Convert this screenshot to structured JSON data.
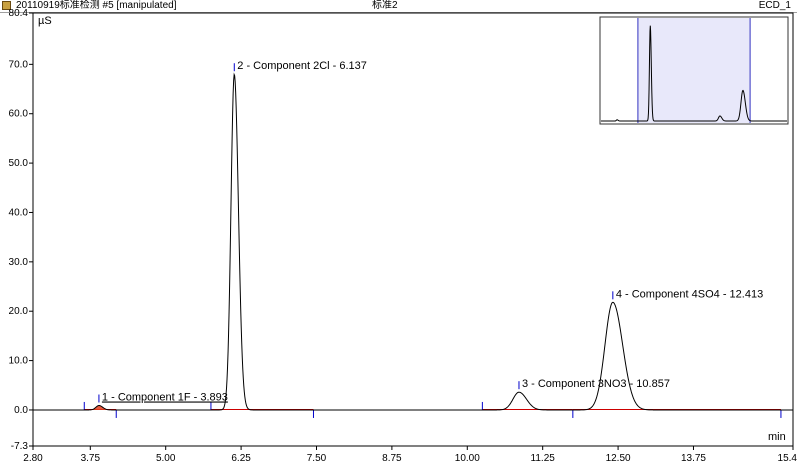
{
  "window": {
    "title": "20110919标准检测 #5 [manipulated]",
    "center_title": "标准2",
    "channel": "ECD_1"
  },
  "chart_data": {
    "type": "line",
    "ylabel": "µS",
    "xlabel": "min",
    "xlim": [
      2.8,
      15.4
    ],
    "ylim": [
      -7.3,
      80.4
    ],
    "x_ticks": [
      "2.80",
      "3.75",
      "5.00",
      "6.25",
      "7.50",
      "8.75",
      "10.00",
      "11.25",
      "12.50",
      "13.75",
      "15.4"
    ],
    "y_ticks": [
      "80.4",
      "70.0",
      "60.0",
      "50.0",
      "40.0",
      "30.0",
      "20.0",
      "10.0",
      "0.0",
      "-7.3"
    ],
    "colors": {
      "trace": "#000000",
      "baseline": "#cc0000",
      "marker": "#0000cc",
      "peak1_label": "#e04020",
      "inset_window": "#e8e8fa"
    },
    "peaks": [
      {
        "label": "1 - Component 1F - 3.893",
        "rt": 3.893,
        "height": 0.9,
        "width": 0.05,
        "color": "#e04020",
        "underline": true
      },
      {
        "label": "2 - Component 2Cl - 6.137",
        "rt": 6.137,
        "height": 68.0,
        "width": 0.055,
        "color": "#000000",
        "underline": false
      },
      {
        "label": "3 - Component 3NO3 - 10.857",
        "rt": 10.857,
        "height": 3.6,
        "width": 0.1,
        "color": "#000000",
        "underline": false
      },
      {
        "label": "4 - Component 4SO4 - 12.413",
        "rt": 12.413,
        "height": 21.8,
        "width": 0.13,
        "color": "#000000",
        "underline": false
      }
    ],
    "baseline_segments": [
      [
        3.65,
        4.18
      ],
      [
        5.75,
        7.45
      ],
      [
        10.25,
        11.75
      ],
      [
        11.75,
        15.2
      ]
    ],
    "integration_marks": [
      {
        "x": 3.65,
        "side": "up"
      },
      {
        "x": 4.18,
        "side": "down"
      },
      {
        "x": 5.75,
        "side": "up"
      },
      {
        "x": 7.45,
        "side": "down"
      },
      {
        "x": 10.25,
        "side": "up"
      },
      {
        "x": 11.75,
        "side": "down"
      },
      {
        "x": 15.2,
        "side": "down"
      }
    ],
    "inset": {
      "xlim": [
        2.8,
        15.4
      ],
      "window": [
        5.3,
        12.9
      ]
    }
  }
}
